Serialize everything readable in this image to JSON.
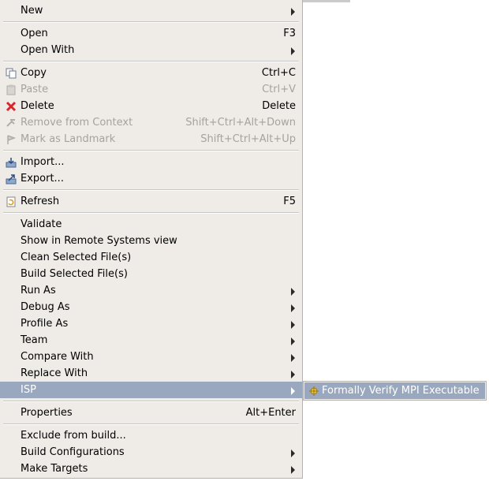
{
  "menu": {
    "items": [
      {
        "label": "New",
        "icon": "",
        "accel": "",
        "submenu": true,
        "disabled": false
      },
      {
        "label": "Open",
        "icon": "",
        "accel": "F3",
        "submenu": false,
        "disabled": false
      },
      {
        "label": "Open With",
        "icon": "",
        "accel": "",
        "submenu": true,
        "disabled": false
      },
      {
        "label": "Copy",
        "icon": "copy-icon",
        "accel": "Ctrl+C",
        "submenu": false,
        "disabled": false
      },
      {
        "label": "Paste",
        "icon": "paste-icon",
        "accel": "Ctrl+V",
        "submenu": false,
        "disabled": true
      },
      {
        "label": "Delete",
        "icon": "delete-icon",
        "accel": "Delete",
        "submenu": false,
        "disabled": false
      },
      {
        "label": "Remove from Context",
        "icon": "remove-context-icon",
        "accel": "Shift+Ctrl+Alt+Down",
        "submenu": false,
        "disabled": true
      },
      {
        "label": "Mark as Landmark",
        "icon": "landmark-icon",
        "accel": "Shift+Ctrl+Alt+Up",
        "submenu": false,
        "disabled": true
      },
      {
        "label": "Import...",
        "icon": "import-icon",
        "accel": "",
        "submenu": false,
        "disabled": false
      },
      {
        "label": "Export...",
        "icon": "export-icon",
        "accel": "",
        "submenu": false,
        "disabled": false
      },
      {
        "label": "Refresh",
        "icon": "refresh-icon",
        "accel": "F5",
        "submenu": false,
        "disabled": false
      },
      {
        "label": "Validate",
        "icon": "",
        "accel": "",
        "submenu": false,
        "disabled": false
      },
      {
        "label": "Show in Remote Systems view",
        "icon": "",
        "accel": "",
        "submenu": false,
        "disabled": false
      },
      {
        "label": "Clean Selected File(s)",
        "icon": "",
        "accel": "",
        "submenu": false,
        "disabled": false
      },
      {
        "label": "Build Selected File(s)",
        "icon": "",
        "accel": "",
        "submenu": false,
        "disabled": false
      },
      {
        "label": "Run As",
        "icon": "",
        "accel": "",
        "submenu": true,
        "disabled": false
      },
      {
        "label": "Debug As",
        "icon": "",
        "accel": "",
        "submenu": true,
        "disabled": false
      },
      {
        "label": "Profile As",
        "icon": "",
        "accel": "",
        "submenu": true,
        "disabled": false
      },
      {
        "label": "Team",
        "icon": "",
        "accel": "",
        "submenu": true,
        "disabled": false
      },
      {
        "label": "Compare With",
        "icon": "",
        "accel": "",
        "submenu": true,
        "disabled": false
      },
      {
        "label": "Replace With",
        "icon": "",
        "accel": "",
        "submenu": true,
        "disabled": false
      },
      {
        "label": "ISP",
        "icon": "",
        "accel": "",
        "submenu": true,
        "disabled": false,
        "selected": true
      },
      {
        "label": "Properties",
        "icon": "",
        "accel": "Alt+Enter",
        "submenu": false,
        "disabled": false
      },
      {
        "label": "Exclude from build...",
        "icon": "",
        "accel": "",
        "submenu": false,
        "disabled": false
      },
      {
        "label": "Build Configurations",
        "icon": "",
        "accel": "",
        "submenu": true,
        "disabled": false
      },
      {
        "label": "Make Targets",
        "icon": "",
        "accel": "",
        "submenu": true,
        "disabled": false
      }
    ]
  },
  "submenu": {
    "items": [
      {
        "label": "Formally Verify MPI Executable",
        "icon": "isp-verify-icon"
      }
    ]
  },
  "colors": {
    "menu_bg": "#efebe7",
    "selection": "#9aa8bf",
    "disabled_text": "#a6a29d"
  }
}
